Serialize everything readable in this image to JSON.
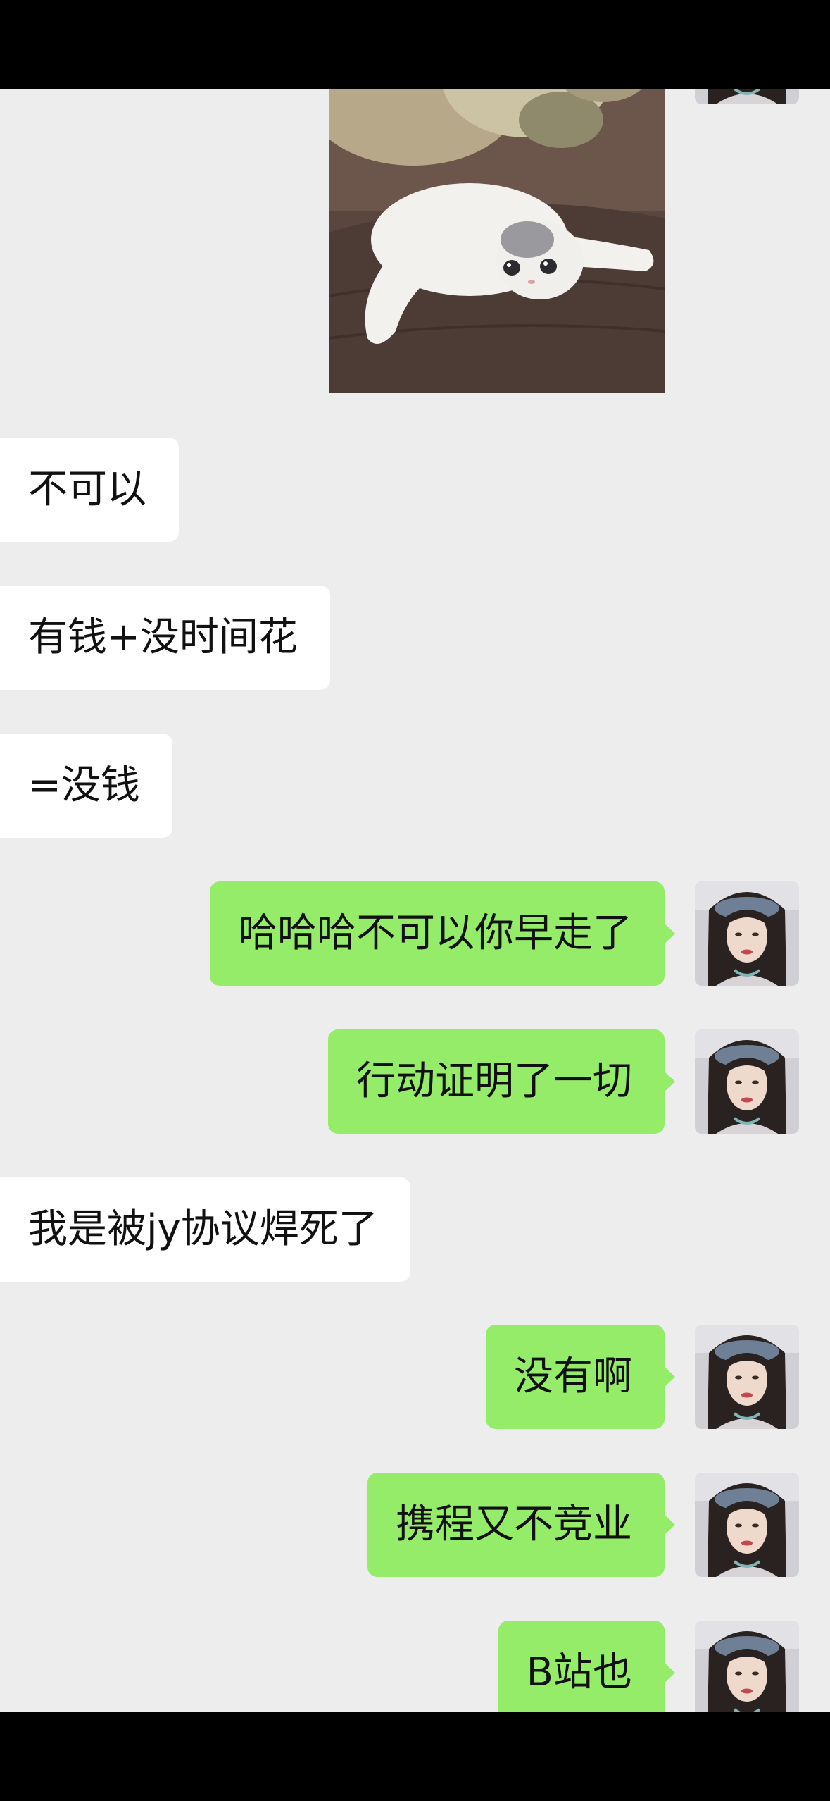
{
  "messages": [
    {
      "side": "out",
      "type": "sticker",
      "sticker": "cat-meme"
    },
    {
      "side": "in",
      "text": "不可以"
    },
    {
      "side": "in",
      "text": "有钱+没时间花"
    },
    {
      "side": "in",
      "text": "=没钱"
    },
    {
      "side": "out",
      "text": "哈哈哈不可以你早走了"
    },
    {
      "side": "out",
      "text": "行动证明了一切"
    },
    {
      "side": "in",
      "text": "我是被jy协议焊死了"
    },
    {
      "side": "out",
      "text": "没有啊"
    },
    {
      "side": "out",
      "text": "携程又不竞业"
    },
    {
      "side": "out",
      "text": "B站也"
    }
  ],
  "colors": {
    "background": "#ededed",
    "incoming_bubble": "#ffffff",
    "outgoing_bubble": "#95ec69",
    "system_bars": "#000000"
  },
  "icons": {
    "avatar": "user-avatar-photo",
    "sticker": "cat-sticker-image"
  }
}
